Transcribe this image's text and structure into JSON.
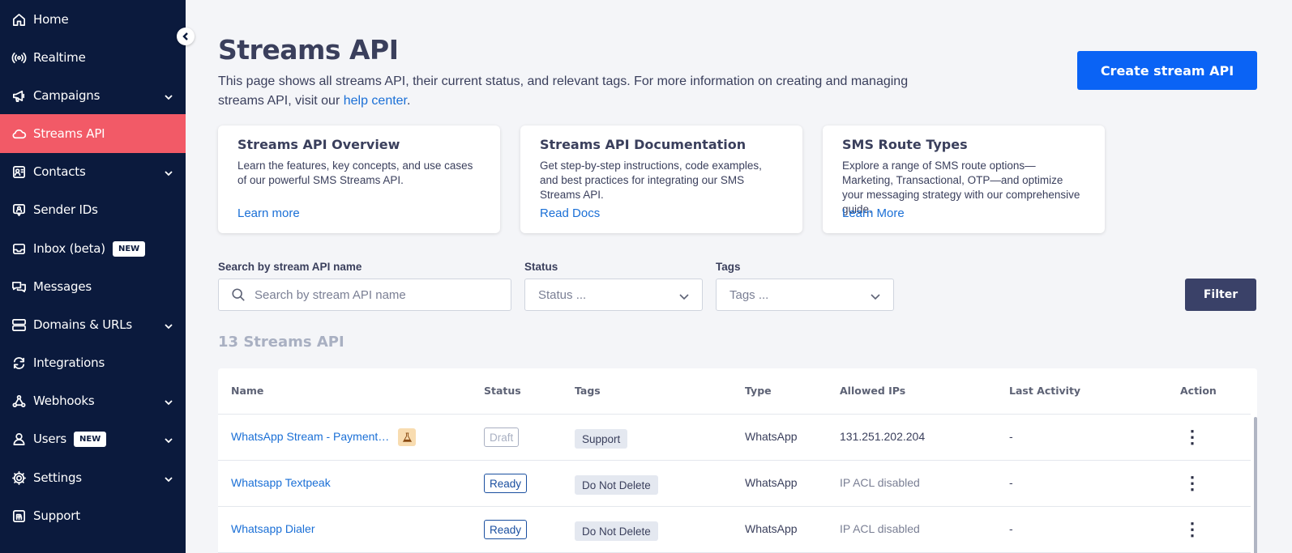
{
  "sidebar": {
    "items": [
      {
        "label": "Home",
        "icon": "home-icon",
        "has_chevron": false
      },
      {
        "label": "Realtime",
        "icon": "broadcast-icon",
        "has_chevron": false
      },
      {
        "label": "Campaigns",
        "icon": "megaphone-icon",
        "has_chevron": true
      },
      {
        "label": "Streams API",
        "icon": "cloud-icon",
        "has_chevron": false,
        "active": true
      },
      {
        "label": "Contacts",
        "icon": "contact-card-icon",
        "has_chevron": true
      },
      {
        "label": "Sender IDs",
        "icon": "sender-id-icon",
        "has_chevron": false
      },
      {
        "label": "Inbox (beta)",
        "icon": "inbox-icon",
        "has_chevron": false,
        "badge": "NEW"
      },
      {
        "label": "Messages",
        "icon": "messages-icon",
        "has_chevron": false
      },
      {
        "label": "Domains & URLs",
        "icon": "server-icon",
        "has_chevron": true
      },
      {
        "label": "Integrations",
        "icon": "sync-icon",
        "has_chevron": false
      },
      {
        "label": "Webhooks",
        "icon": "webhook-icon",
        "has_chevron": true
      },
      {
        "label": "Users",
        "icon": "user-icon",
        "has_chevron": true,
        "badge": "NEW"
      },
      {
        "label": "Settings",
        "icon": "gear-icon",
        "has_chevron": true
      },
      {
        "label": "Support",
        "icon": "support-icon",
        "has_chevron": false
      }
    ]
  },
  "header": {
    "title": "Streams API",
    "description_before": "This page shows all streams API, their current status, and relevant tags. For more information on creating and managing streams API, visit our ",
    "help_link": "help center",
    "description_after": ".",
    "create_button": "Create stream API"
  },
  "cards": [
    {
      "title": "Streams API Overview",
      "description": "Learn the features, key concepts, and use cases of our powerful SMS Streams API.",
      "link": "Learn more"
    },
    {
      "title": "Streams API Documentation",
      "description": "Get step-by-step instructions, code examples, and best practices for integrating our SMS Streams API.",
      "link": "Read Docs"
    },
    {
      "title": "SMS Route Types",
      "description": "Explore a range of SMS route options—Marketing, Transactional, OTP—and optimize your messaging strategy with our comprehensive guide.",
      "link": "Learn More"
    }
  ],
  "filters": {
    "search_label": "Search by stream API name",
    "search_placeholder": "Search by stream API name",
    "status_label": "Status",
    "status_placeholder": "Status ...",
    "tags_label": "Tags",
    "tags_placeholder": "Tags ...",
    "filter_button": "Filter"
  },
  "table": {
    "count_label": "13 Streams API",
    "columns": [
      "Name",
      "Status",
      "Tags",
      "Type",
      "Allowed IPs",
      "Last Activity",
      "Action"
    ],
    "rows": [
      {
        "name": "WhatsApp Stream - Payment Su…",
        "beta": true,
        "status": "Draft",
        "tag": "Support",
        "type": "WhatsApp",
        "allowed_ips": "131.251.202.204",
        "last_activity": "-"
      },
      {
        "name": "Whatsapp Textpeak",
        "beta": false,
        "status": "Ready",
        "tag": "Do Not Delete",
        "type": "WhatsApp",
        "allowed_ips": "IP ACL disabled",
        "last_activity": "-"
      },
      {
        "name": "Whatsapp Dialer",
        "beta": false,
        "status": "Ready",
        "tag": "Do Not Delete",
        "type": "WhatsApp",
        "allowed_ips": "IP ACL disabled",
        "last_activity": "-"
      }
    ]
  },
  "colors": {
    "sidebar_bg": "#0b1a3d",
    "active_item": "#f25a67",
    "primary_button": "#0a63f5",
    "link": "#1a6fd6"
  }
}
